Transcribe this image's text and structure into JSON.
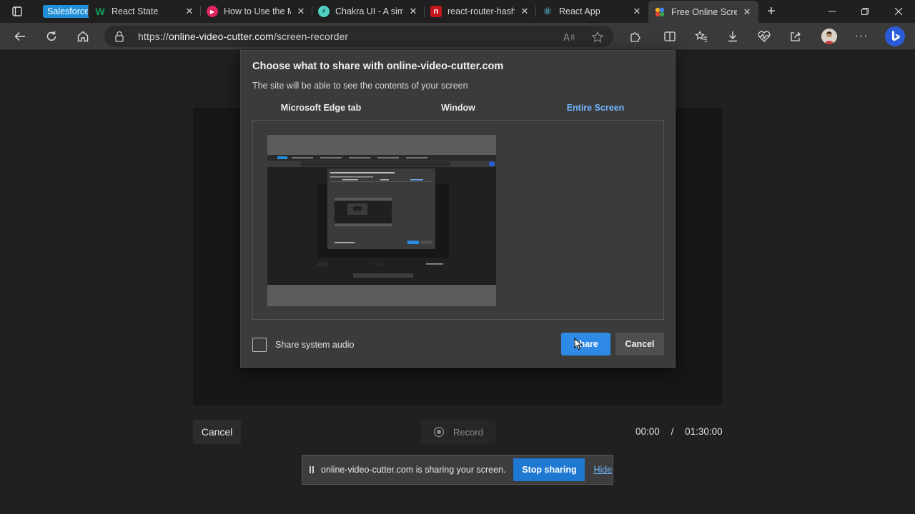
{
  "browser": {
    "tabs": [
      {
        "label": "Salesforce",
        "type": "chip"
      },
      {
        "label": "React State",
        "icon": "W",
        "icon_color": "#0f9d58",
        "icon_bg": "transparent"
      },
      {
        "label": "How to Use the M",
        "icon": "▶",
        "icon_color": "#ffffff",
        "icon_bg": "#e0245e"
      },
      {
        "label": "Chakra UI - A sim",
        "icon": "⚡",
        "icon_color": "#1a1a1a",
        "icon_bg": "#4fd1c5"
      },
      {
        "label": "react-router-hash",
        "icon": "n",
        "icon_color": "#ffffff",
        "icon_bg": "#c4161c"
      },
      {
        "label": "React App",
        "icon": "⚛",
        "icon_color": "#61dafb",
        "icon_bg": "transparent"
      },
      {
        "label": "Free Online Scree",
        "icon": "●",
        "icon_color": "#f2b01e",
        "icon_bg": "transparent",
        "active": true
      }
    ],
    "url_scheme": "https://",
    "url_host": "online-video-cutter.com",
    "url_path": "/screen-recorder"
  },
  "page": {
    "cancel_label": "Cancel",
    "record_label": "Record",
    "timer_current": "00:00",
    "timer_sep": "/",
    "timer_total": "01:30:00"
  },
  "dialog": {
    "title": "Choose what to share with online-video-cutter.com",
    "subtitle": "The site will be able to see the contents of your screen",
    "tabs": [
      "Microsoft Edge tab",
      "Window",
      "Entire Screen"
    ],
    "active_tab": 2,
    "audio_label": "Share system audio",
    "share_label": "Share",
    "cancel_label": "Cancel"
  },
  "sharebar": {
    "message": "online-video-cutter.com is sharing your screen.",
    "stop_label": "Stop sharing",
    "hide_label": "Hide"
  }
}
